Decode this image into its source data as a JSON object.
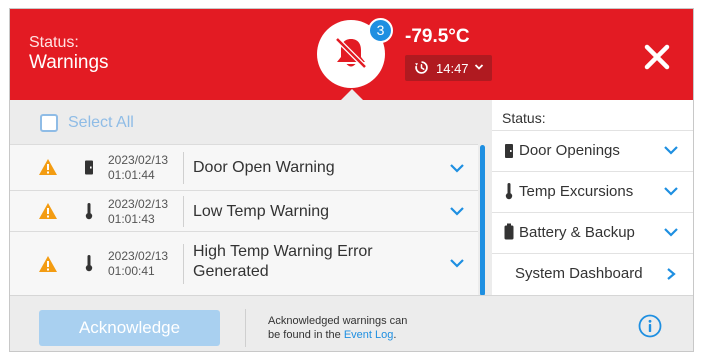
{
  "header": {
    "status_label": "Status:",
    "status_value": "Warnings",
    "alarm_count": "3",
    "temperature": "-79.5°C",
    "time": "14:47",
    "icons": {
      "bell": "bell-muted-icon",
      "clock": "timer-icon",
      "close": "close-icon"
    }
  },
  "list": {
    "select_all_label": "Select All",
    "rows": [
      {
        "date": "2023/02/13",
        "time": "01:01:44",
        "title": "Door Open Warning",
        "device_icon": "door-icon"
      },
      {
        "date": "2023/02/13",
        "time": "01:01:43",
        "title": "Low Temp Warning",
        "device_icon": "thermometer-icon"
      },
      {
        "date": "2023/02/13",
        "time": "01:00:41",
        "title_line1": "High Temp Warning Error",
        "title_line2": "Generated",
        "device_icon": "thermometer-icon"
      }
    ]
  },
  "status_panel": {
    "title": "Status:",
    "items": [
      {
        "label": "Door Openings",
        "icon": "door-icon"
      },
      {
        "label": "Temp Excursions",
        "icon": "thermometer-icon"
      },
      {
        "label": "Battery & Backup",
        "icon": "battery-icon"
      },
      {
        "label": "System Dashboard"
      }
    ]
  },
  "footer": {
    "acknowledge_label": "Acknowledge",
    "note_line1": "Acknowledged warnings can",
    "note_line2_prefix": "be found in the ",
    "note_link": "Event Log",
    "note_suffix": "."
  },
  "colors": {
    "header_red": "#e31b23",
    "time_button": "#b01a20",
    "accent_blue": "#1e8fe1",
    "warning_orange": "#f39c12",
    "ack_button": "#a9d0f0"
  }
}
